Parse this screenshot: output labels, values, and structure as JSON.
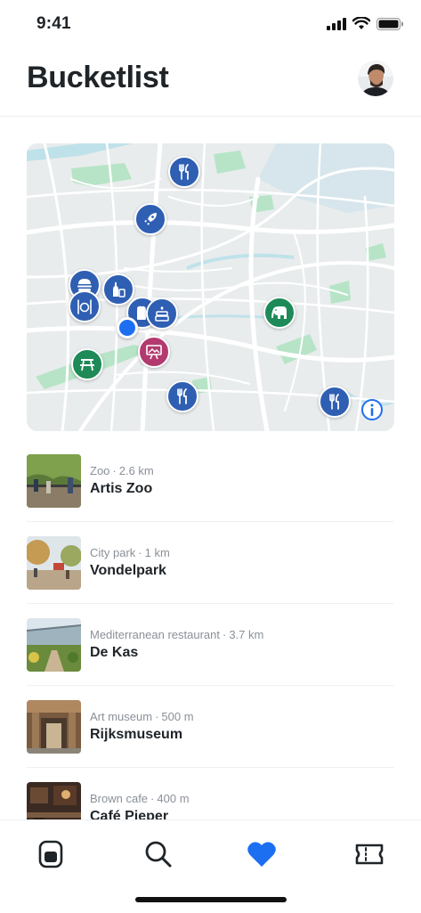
{
  "status_bar": {
    "time": "9:41"
  },
  "header": {
    "title": "Bucketlist"
  },
  "map": {
    "pins": [
      {
        "icon": "fork-knife-icon",
        "color": "blue"
      },
      {
        "icon": "rocket-icon",
        "color": "blue"
      },
      {
        "icon": "burger-icon",
        "color": "blue"
      },
      {
        "icon": "fork-knife-icon",
        "color": "blue"
      },
      {
        "icon": "bottle-icon",
        "color": "blue"
      },
      {
        "icon": "beer-icon",
        "color": "blue"
      },
      {
        "icon": "cake-icon",
        "color": "blue"
      },
      {
        "icon": "picnic-table-icon",
        "color": "green"
      },
      {
        "icon": "art-frame-icon",
        "color": "pink"
      },
      {
        "icon": "fork-knife-icon",
        "color": "blue"
      },
      {
        "icon": "elephant-icon",
        "color": "green"
      },
      {
        "icon": "fork-knife-icon",
        "color": "blue"
      }
    ],
    "colors": {
      "blue": "#2f5fb3",
      "green": "#1e8a57",
      "pink": "#b23a6e",
      "location": "#1d6ff2",
      "park": "#b7e4c7",
      "water": "#bfe2ea"
    }
  },
  "places": [
    {
      "category": "Zoo",
      "distance": "2.6 km",
      "name": "Artis Zoo"
    },
    {
      "category": "City park",
      "distance": "1 km",
      "name": "Vondelpark"
    },
    {
      "category": "Mediterranean restaurant",
      "distance": "3.7 km",
      "name": "De Kas"
    },
    {
      "category": "Art museum",
      "distance": "500 m",
      "name": "Rijksmuseum"
    },
    {
      "category": "Brown cafe",
      "distance": "400 m",
      "name": "Café Pieper"
    }
  ],
  "tab_bar": {
    "tabs": [
      {
        "icon": "home-app-icon",
        "active": false
      },
      {
        "icon": "search-icon",
        "active": false
      },
      {
        "icon": "heart-icon",
        "active": true
      },
      {
        "icon": "ticket-icon",
        "active": false
      }
    ],
    "active_color": "#1d6ff2"
  }
}
